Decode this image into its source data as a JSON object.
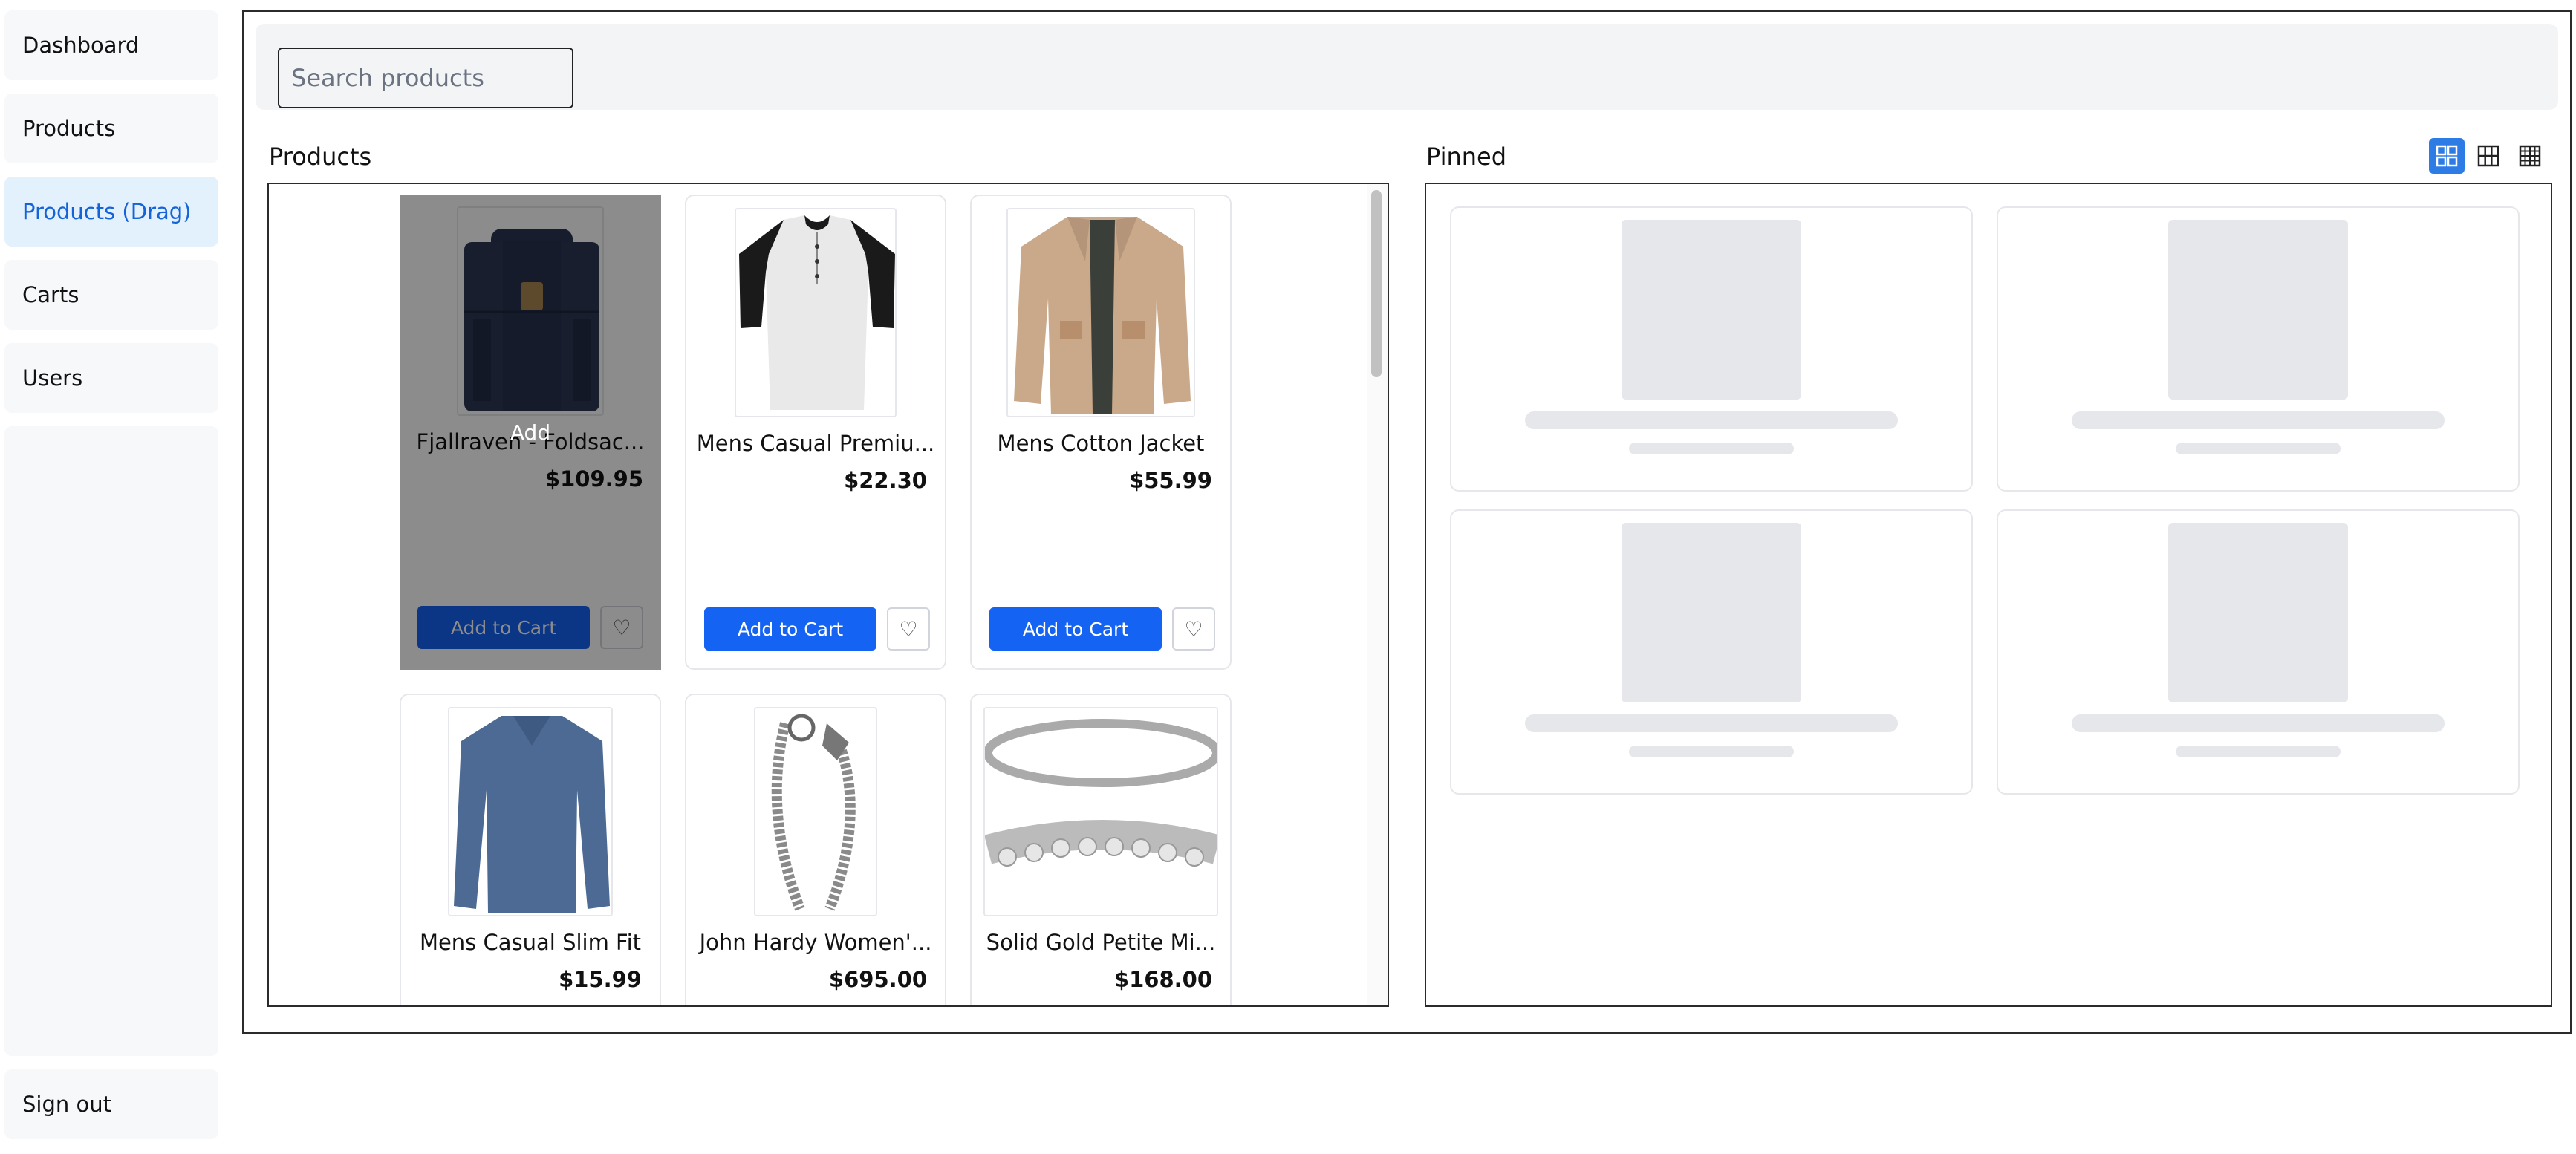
{
  "sidebar": {
    "items": [
      {
        "label": "Dashboard",
        "active": false
      },
      {
        "label": "Products",
        "active": false
      },
      {
        "label": "Products (Drag)",
        "active": true
      },
      {
        "label": "Carts",
        "active": false
      },
      {
        "label": "Users",
        "active": false
      }
    ],
    "signout_label": "Sign out"
  },
  "search": {
    "placeholder": "Search products",
    "value": ""
  },
  "products_section": {
    "title": "Products",
    "drag_label": "Add",
    "cards": [
      {
        "name": "Fjallraven - Foldsac...",
        "price": "$109.95",
        "add_label": "Add to Cart",
        "fav_icon": "heart-icon",
        "dragging": true
      },
      {
        "name": "Mens Casual Premiu...",
        "price": "$22.30",
        "add_label": "Add to Cart",
        "fav_icon": "heart-icon"
      },
      {
        "name": "Mens Cotton Jacket",
        "price": "$55.99",
        "add_label": "Add to Cart",
        "fav_icon": "heart-icon"
      },
      {
        "name": "Mens Casual Slim Fit",
        "price": "$15.99"
      },
      {
        "name": "John Hardy Women'...",
        "price": "$695.00"
      },
      {
        "name": "Solid Gold Petite Mi...",
        "price": "$168.00"
      }
    ]
  },
  "pinned_section": {
    "title": "Pinned",
    "view_modes": [
      {
        "icon": "grid-2x2-icon",
        "active": true
      },
      {
        "icon": "grid-3x3-icon",
        "active": false
      },
      {
        "icon": "grid-4x4-icon",
        "active": false
      }
    ],
    "placeholder_count": 4
  },
  "colors": {
    "accent": "#1463f3",
    "active_nav_bg": "#e3f1fd",
    "active_nav_text": "#1463d8",
    "toggle_active": "#2d7be5"
  }
}
